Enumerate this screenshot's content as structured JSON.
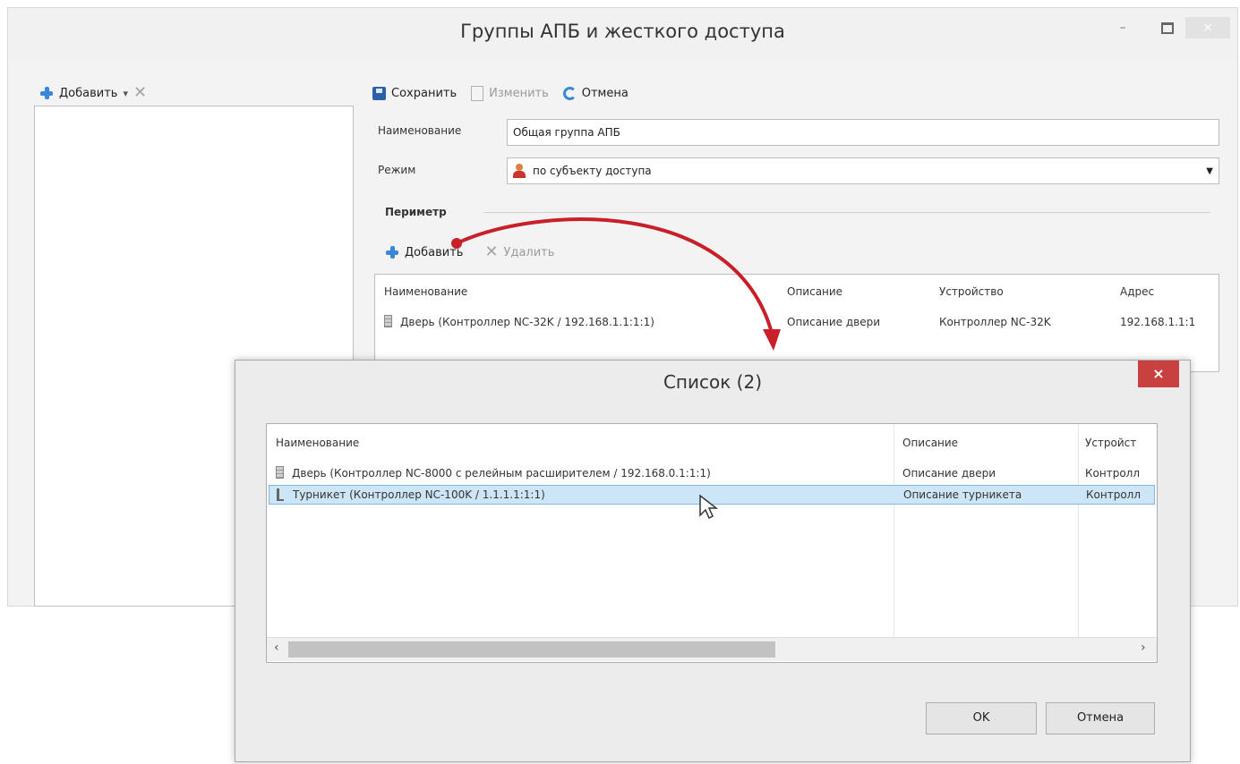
{
  "main_window": {
    "title": "Группы АПБ и жесткого доступа",
    "min_glyph": "–",
    "close_glyph": "×"
  },
  "left_panel": {
    "add_label": "Добавить",
    "dropdown_glyph": "▾"
  },
  "toolbar": {
    "save_label": "Сохранить",
    "edit_label": "Изменить",
    "cancel_label": "Отмена"
  },
  "form": {
    "name_label": "Наименование",
    "name_value": "Общая группа АПБ",
    "mode_label": "Режим",
    "mode_value": "по субъекту доступа",
    "section_title": "Периметр"
  },
  "perimeter": {
    "add_label": "Добавить",
    "delete_label": "Удалить",
    "columns": [
      "Наименование",
      "Описание",
      "Устройство",
      "Адрес"
    ],
    "rows": [
      [
        "Дверь (Контроллер NC-32K / 192.168.1.1:1:1)",
        "Описание двери",
        "Контроллер NC-32K",
        "192.168.1.1:1"
      ]
    ]
  },
  "dialog": {
    "title": "Список (2)",
    "close_glyph": "×",
    "columns": [
      "Наименование",
      "Описание",
      "Устройст"
    ],
    "rows": [
      [
        "Дверь (Контроллер NC-8000 с релейным расширителем / 192.168.0.1:1:1)",
        "Описание двери",
        "Контролл"
      ],
      [
        "Турникет (Контроллер NC-100K / 1.1.1.1:1:1)",
        "Описание турникета",
        "Контролл"
      ]
    ],
    "selected_row": 1,
    "scroll_left": "‹",
    "scroll_right": "›",
    "ok_label": "OK",
    "cancel_label": "Отмена"
  },
  "colors": {
    "arrow": "#c8202a",
    "selection": "#cde6f7",
    "close_red": "#c94040"
  }
}
